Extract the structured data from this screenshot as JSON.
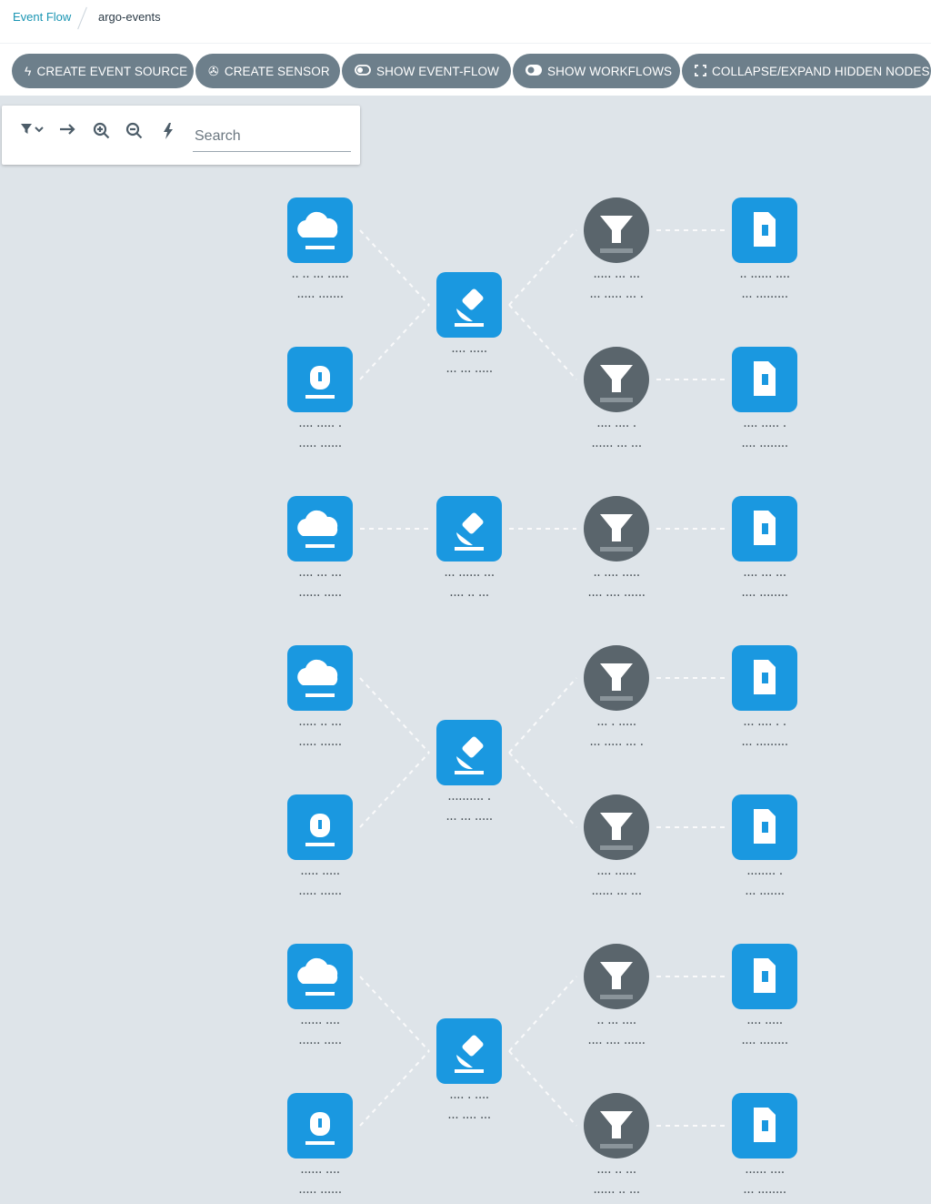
{
  "breadcrumb": {
    "parent": "Event Flow",
    "current": "argo-events"
  },
  "toolbar": {
    "create_event_source": "CREATE EVENT SOURCE",
    "create_sensor": "CREATE SENSOR",
    "show_event_flow": "SHOW EVENT-FLOW",
    "show_workflows": "SHOW WORKFLOWS",
    "collapse_expand": "COLLAPSE/EXPAND HIDDEN NODES"
  },
  "graph_controls": {
    "icons": [
      "filter-icon",
      "direction-arrow-icon",
      "zoom-in-icon",
      "zoom-out-icon",
      "lightning-icon"
    ],
    "search_placeholder": "Search"
  },
  "colors": {
    "accent": "#1a95b3",
    "button_bg": "#6d7f8b",
    "canvas_bg": "#dee4e9",
    "event_node": "#1a98e0",
    "filter_node": "#5a656c",
    "edge": "#ffffff"
  },
  "graph": {
    "groups": [
      {
        "sources": [
          {
            "kind": "cloud",
            "label_lines": [
              "·· ·· ··· ······",
              "····· ·······"
            ]
          },
          {
            "kind": "webhook",
            "label_lines": [
              "···· ····· ·",
              "····· ······"
            ]
          }
        ],
        "sensor": {
          "label_lines": [
            "···· ·····",
            "··· ··· ·····"
          ]
        },
        "filters": [
          {
            "label_lines": [
              "····· ··· ···",
              "··· ····· ··· ·"
            ]
          },
          {
            "label_lines": [
              "···· ···· ·",
              "······ ··· ···"
            ]
          }
        ],
        "triggers": [
          {
            "label_lines": [
              "·· ······ ····",
              "··· ·········"
            ]
          },
          {
            "label_lines": [
              "···· ····· ·",
              "···· ········"
            ]
          }
        ]
      },
      {
        "sources": [
          {
            "kind": "cloud",
            "label_lines": [
              "···· ··· ···",
              "······ ·····"
            ]
          }
        ],
        "sensor": {
          "label_lines": [
            "··· ······ ···",
            "···· ·· ···"
          ]
        },
        "filters": [
          {
            "label_lines": [
              "·· ···· ·····",
              "···· ···· ······"
            ]
          }
        ],
        "triggers": [
          {
            "label_lines": [
              "···· ··· ···",
              "···· ········"
            ]
          }
        ]
      },
      {
        "sources": [
          {
            "kind": "cloud",
            "label_lines": [
              "····· ·· ···",
              "····· ······"
            ]
          },
          {
            "kind": "webhook",
            "label_lines": [
              "····· ·····",
              "····· ······"
            ]
          }
        ],
        "sensor": {
          "label_lines": [
            "·········· ·",
            "··· ··· ·····"
          ]
        },
        "filters": [
          {
            "label_lines": [
              "··· · ·····",
              "··· ····· ··· ·"
            ]
          },
          {
            "label_lines": [
              "···· ······",
              "······ ··· ···"
            ]
          }
        ],
        "triggers": [
          {
            "label_lines": [
              "··· ···· · ·",
              "··· ·········"
            ]
          },
          {
            "label_lines": [
              "········ ·",
              "··· ·······"
            ]
          }
        ]
      },
      {
        "sources": [
          {
            "kind": "cloud",
            "label_lines": [
              "······ ····",
              "······ ·····"
            ]
          },
          {
            "kind": "webhook",
            "label_lines": [
              "······ ····",
              "····· ······"
            ]
          }
        ],
        "sensor": {
          "label_lines": [
            "···· · ····",
            "··· ···· ···"
          ]
        },
        "filters": [
          {
            "label_lines": [
              "·· ··· ····",
              "···· ···· ······"
            ]
          },
          {
            "label_lines": [
              "···· ·· ···",
              "······ ·· ···"
            ]
          }
        ],
        "triggers": [
          {
            "label_lines": [
              "···· ·····",
              "···· ········"
            ]
          },
          {
            "label_lines": [
              "······ ····",
              "··· ········"
            ]
          }
        ]
      }
    ]
  }
}
